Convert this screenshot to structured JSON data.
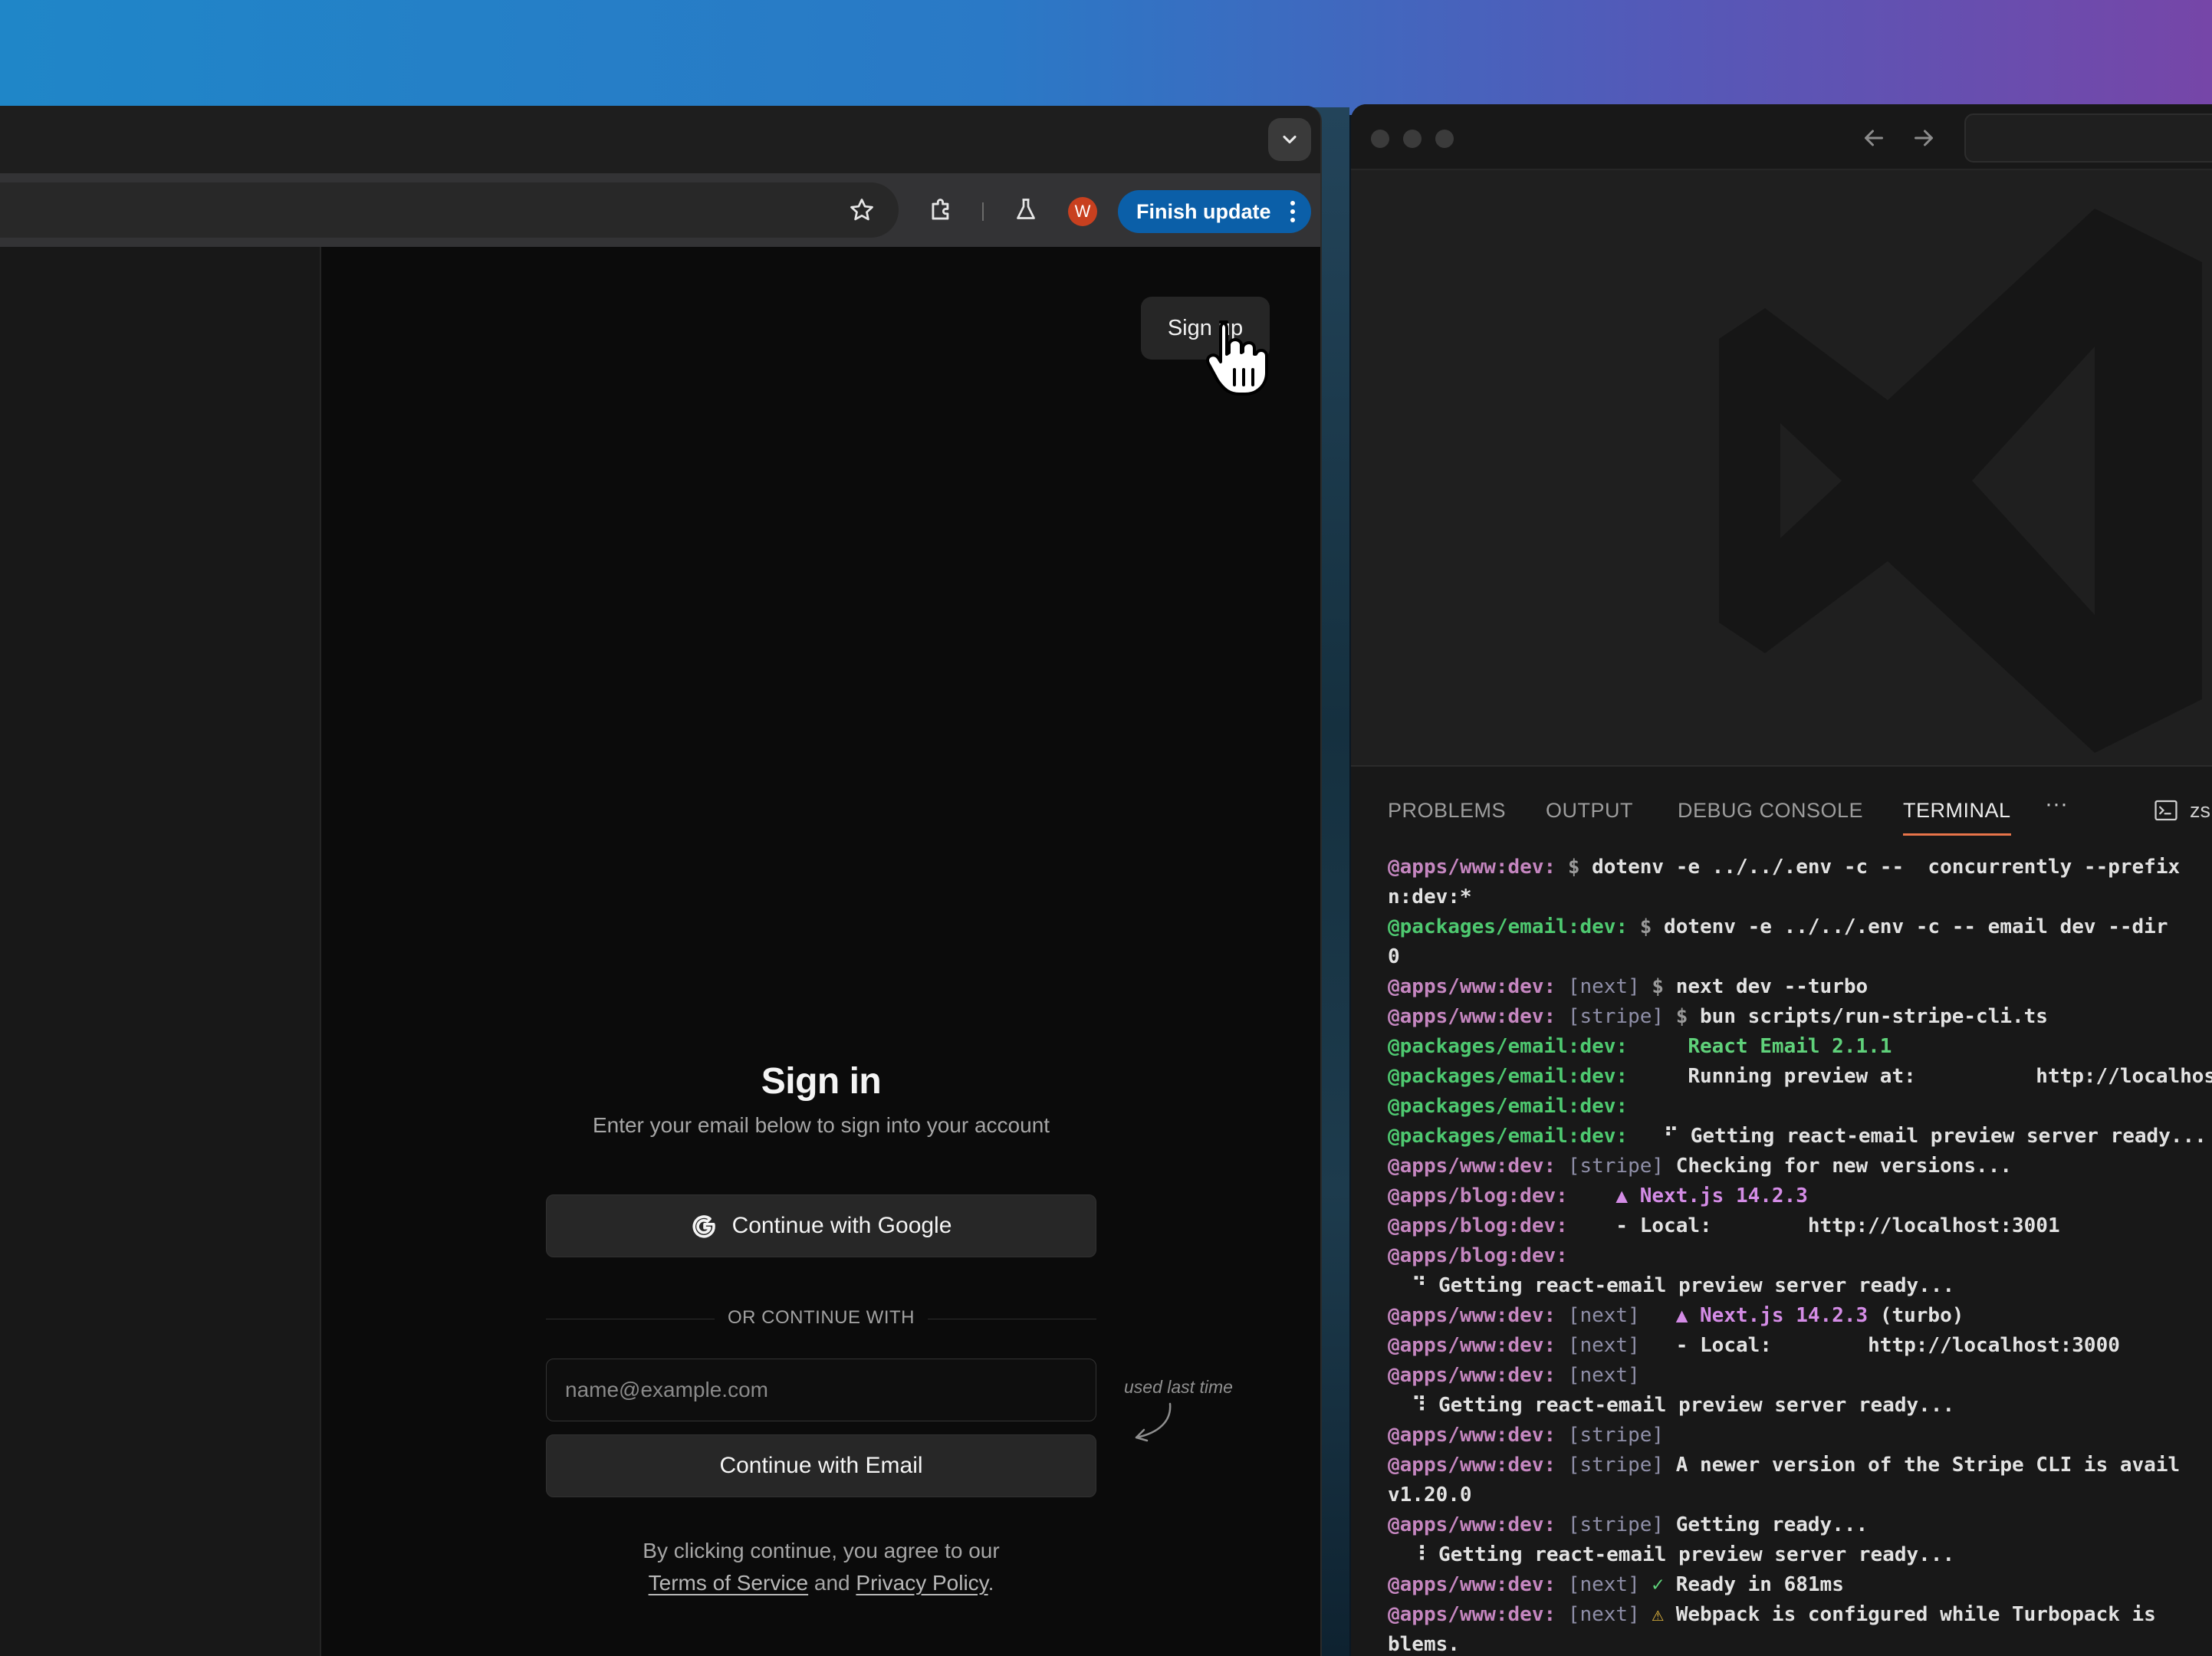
{
  "browser": {
    "finish_update_label": "Finish update",
    "avatar_letter": "W",
    "signup_label": "Sign up",
    "signin": {
      "title": "Sign in",
      "subtitle": "Enter your email below to sign into your account",
      "google_label": "Continue with Google",
      "divider_label": "OR CONTINUE WITH",
      "email_placeholder": "name@example.com",
      "email_value": "",
      "email_button_label": "Continue with Email",
      "used_last_time": "used last time",
      "legal_prefix": "By clicking continue, you agree to our",
      "terms_label": "Terms of Service",
      "and": "and",
      "privacy_label": "Privacy Policy",
      "period": "."
    },
    "icons": [
      "chevron-down-icon",
      "star-icon",
      "extensions-icon",
      "labs-icon",
      "kebab-menu-icon",
      "google-icon",
      "hand-cursor-icon",
      "curved-arrow-icon"
    ]
  },
  "vscode": {
    "panel_tabs": [
      {
        "label": "PROBLEMS",
        "active": false
      },
      {
        "label": "OUTPUT",
        "active": false
      },
      {
        "label": "DEBUG CONSOLE",
        "active": false
      },
      {
        "label": "TERMINAL",
        "active": true
      }
    ],
    "more_label": "···",
    "shell_label": "zs",
    "accent": "#e8744a",
    "terminal_lines": [
      [
        {
          "c": "p",
          "t": "@apps/www:dev: "
        },
        {
          "c": "d",
          "t": "$ "
        },
        {
          "c": "n",
          "t": "dotenv -e ../../.env -c --  concurrently --prefix"
        }
      ],
      [
        {
          "c": "n",
          "t": "n:dev:*"
        }
      ],
      [
        {
          "c": "g",
          "t": "@packages/email:dev: "
        },
        {
          "c": "d",
          "t": "$ "
        },
        {
          "c": "n",
          "t": "dotenv -e ../../.env -c -- email dev --dir"
        }
      ],
      [
        {
          "c": "n",
          "t": "0"
        }
      ],
      [
        {
          "c": "p",
          "t": "@apps/www:dev: "
        },
        {
          "c": "l",
          "t": "[next] "
        },
        {
          "c": "d",
          "t": "$ "
        },
        {
          "c": "n",
          "t": "next dev --turbo"
        }
      ],
      [
        {
          "c": "p",
          "t": "@apps/www:dev: "
        },
        {
          "c": "l",
          "t": "[stripe] "
        },
        {
          "c": "d",
          "t": "$ "
        },
        {
          "c": "n",
          "t": "bun scripts/run-stripe-cli.ts"
        }
      ],
      [
        {
          "c": "g",
          "t": "@packages/email:dev:     "
        },
        {
          "c": "hg",
          "t": "React Email 2.1.1"
        }
      ],
      [
        {
          "c": "g",
          "t": "@packages/email:dev:     "
        },
        {
          "c": "n",
          "t": "Running preview at:          http://localhost"
        }
      ],
      [
        {
          "c": "g",
          "t": "@packages/email:dev: "
        }
      ],
      [
        {
          "c": "g",
          "t": "@packages/email:dev:   "
        },
        {
          "c": "n",
          "t": "⠋ Getting react-email preview server ready..."
        }
      ],
      [
        {
          "c": "p",
          "t": "@apps/www:dev: "
        },
        {
          "c": "l",
          "t": "[stripe] "
        },
        {
          "c": "n",
          "t": "Checking for new versions..."
        }
      ],
      [
        {
          "c": "p",
          "t": "@apps/blog:dev:    "
        },
        {
          "c": "hp",
          "t": "▲ Next.js 14.2.3"
        }
      ],
      [
        {
          "c": "p",
          "t": "@apps/blog:dev:    "
        },
        {
          "c": "n",
          "t": "- Local:        http://localhost:3001"
        }
      ],
      [
        {
          "c": "p",
          "t": "@apps/blog:dev: "
        }
      ],
      [
        {
          "c": "n",
          "t": "  ⠙ Getting react-email preview server ready..."
        }
      ],
      [
        {
          "c": "p",
          "t": "@apps/www:dev: "
        },
        {
          "c": "l",
          "t": "[next]   "
        },
        {
          "c": "hp",
          "t": "▲ Next.js 14.2.3 "
        },
        {
          "c": "n",
          "t": "(turbo)"
        }
      ],
      [
        {
          "c": "p",
          "t": "@apps/www:dev: "
        },
        {
          "c": "l",
          "t": "[next]   "
        },
        {
          "c": "n",
          "t": "- Local:        http://localhost:3000"
        }
      ],
      [
        {
          "c": "p",
          "t": "@apps/www:dev: "
        },
        {
          "c": "l",
          "t": "[next]"
        }
      ],
      [
        {
          "c": "n",
          "t": "  ⠹ Getting react-email preview server ready..."
        }
      ],
      [
        {
          "c": "p",
          "t": "@apps/www:dev: "
        },
        {
          "c": "l",
          "t": "[stripe]"
        }
      ],
      [
        {
          "c": "p",
          "t": "@apps/www:dev: "
        },
        {
          "c": "l",
          "t": "[stripe] "
        },
        {
          "c": "n",
          "t": "A newer version of the Stripe CLI is avail"
        }
      ],
      [
        {
          "c": "n",
          "t": "v1.20.0"
        }
      ],
      [
        {
          "c": "p",
          "t": "@apps/www:dev: "
        },
        {
          "c": "l",
          "t": "[stripe] "
        },
        {
          "c": "n",
          "t": "Getting ready..."
        }
      ],
      [
        {
          "c": "n",
          "t": "  ⠸ Getting react-email preview server ready..."
        }
      ],
      [
        {
          "c": "p",
          "t": "@apps/www:dev: "
        },
        {
          "c": "l",
          "t": "[next] "
        },
        {
          "c": "hg",
          "t": "✓ "
        },
        {
          "c": "n",
          "t": "Ready in 681ms"
        }
      ],
      [
        {
          "c": "p",
          "t": "@apps/www:dev: "
        },
        {
          "c": "l",
          "t": "[next] "
        },
        {
          "c": "w",
          "t": "⚠ "
        },
        {
          "c": "n",
          "t": "Webpack is configured while Turbopack is"
        }
      ],
      [
        {
          "c": "n",
          "t": "blems."
        }
      ]
    ]
  }
}
